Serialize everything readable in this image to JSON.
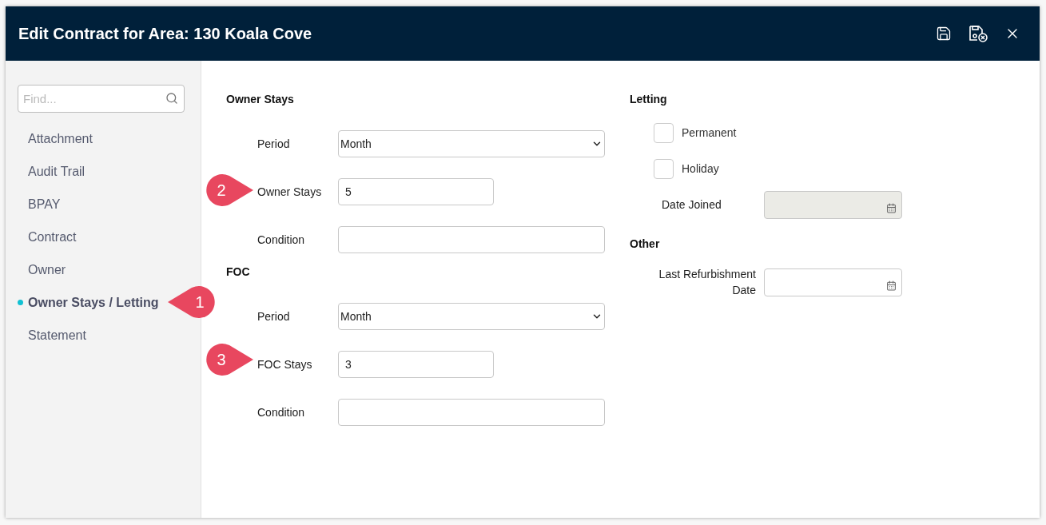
{
  "window": {
    "title": "Edit Contract for Area: 130 Koala Cove"
  },
  "sidebar": {
    "search": {
      "placeholder": "Find..."
    },
    "items": [
      {
        "label": "Attachment",
        "selected": false
      },
      {
        "label": "Audit Trail",
        "selected": false
      },
      {
        "label": "BPAY",
        "selected": false
      },
      {
        "label": "Contract",
        "selected": false
      },
      {
        "label": "Owner",
        "selected": false
      },
      {
        "label": "Owner Stays / Letting",
        "selected": true
      },
      {
        "label": "Statement",
        "selected": false
      }
    ]
  },
  "left_sections": [
    {
      "title": "Owner Stays",
      "fields": [
        {
          "kind": "select",
          "label": "Period",
          "value": "Month"
        },
        {
          "kind": "number",
          "label": "Owner Stays",
          "value": "5"
        },
        {
          "kind": "text",
          "label": "Condition"
        }
      ]
    },
    {
      "title": "FOC",
      "fields": [
        {
          "kind": "select",
          "label": "Period",
          "value": "Month"
        },
        {
          "kind": "number",
          "label": "FOC Stays",
          "value": "3"
        },
        {
          "kind": "text",
          "label": "Condition"
        }
      ]
    }
  ],
  "letting": {
    "title": "Letting",
    "checkboxes": [
      {
        "label": "Permanent",
        "checked": false
      },
      {
        "label": "Holiday",
        "checked": false
      }
    ],
    "date_joined": {
      "label": "Date Joined",
      "disabled": true
    }
  },
  "other": {
    "title": "Other",
    "last_refurbishment": {
      "label": "Last Refurbishment Date",
      "disabled": false
    }
  },
  "callouts": [
    {
      "number": "1",
      "kind": "leftward"
    },
    {
      "number": "2",
      "kind": "rightward"
    },
    {
      "number": "3",
      "kind": "rightward"
    }
  ]
}
